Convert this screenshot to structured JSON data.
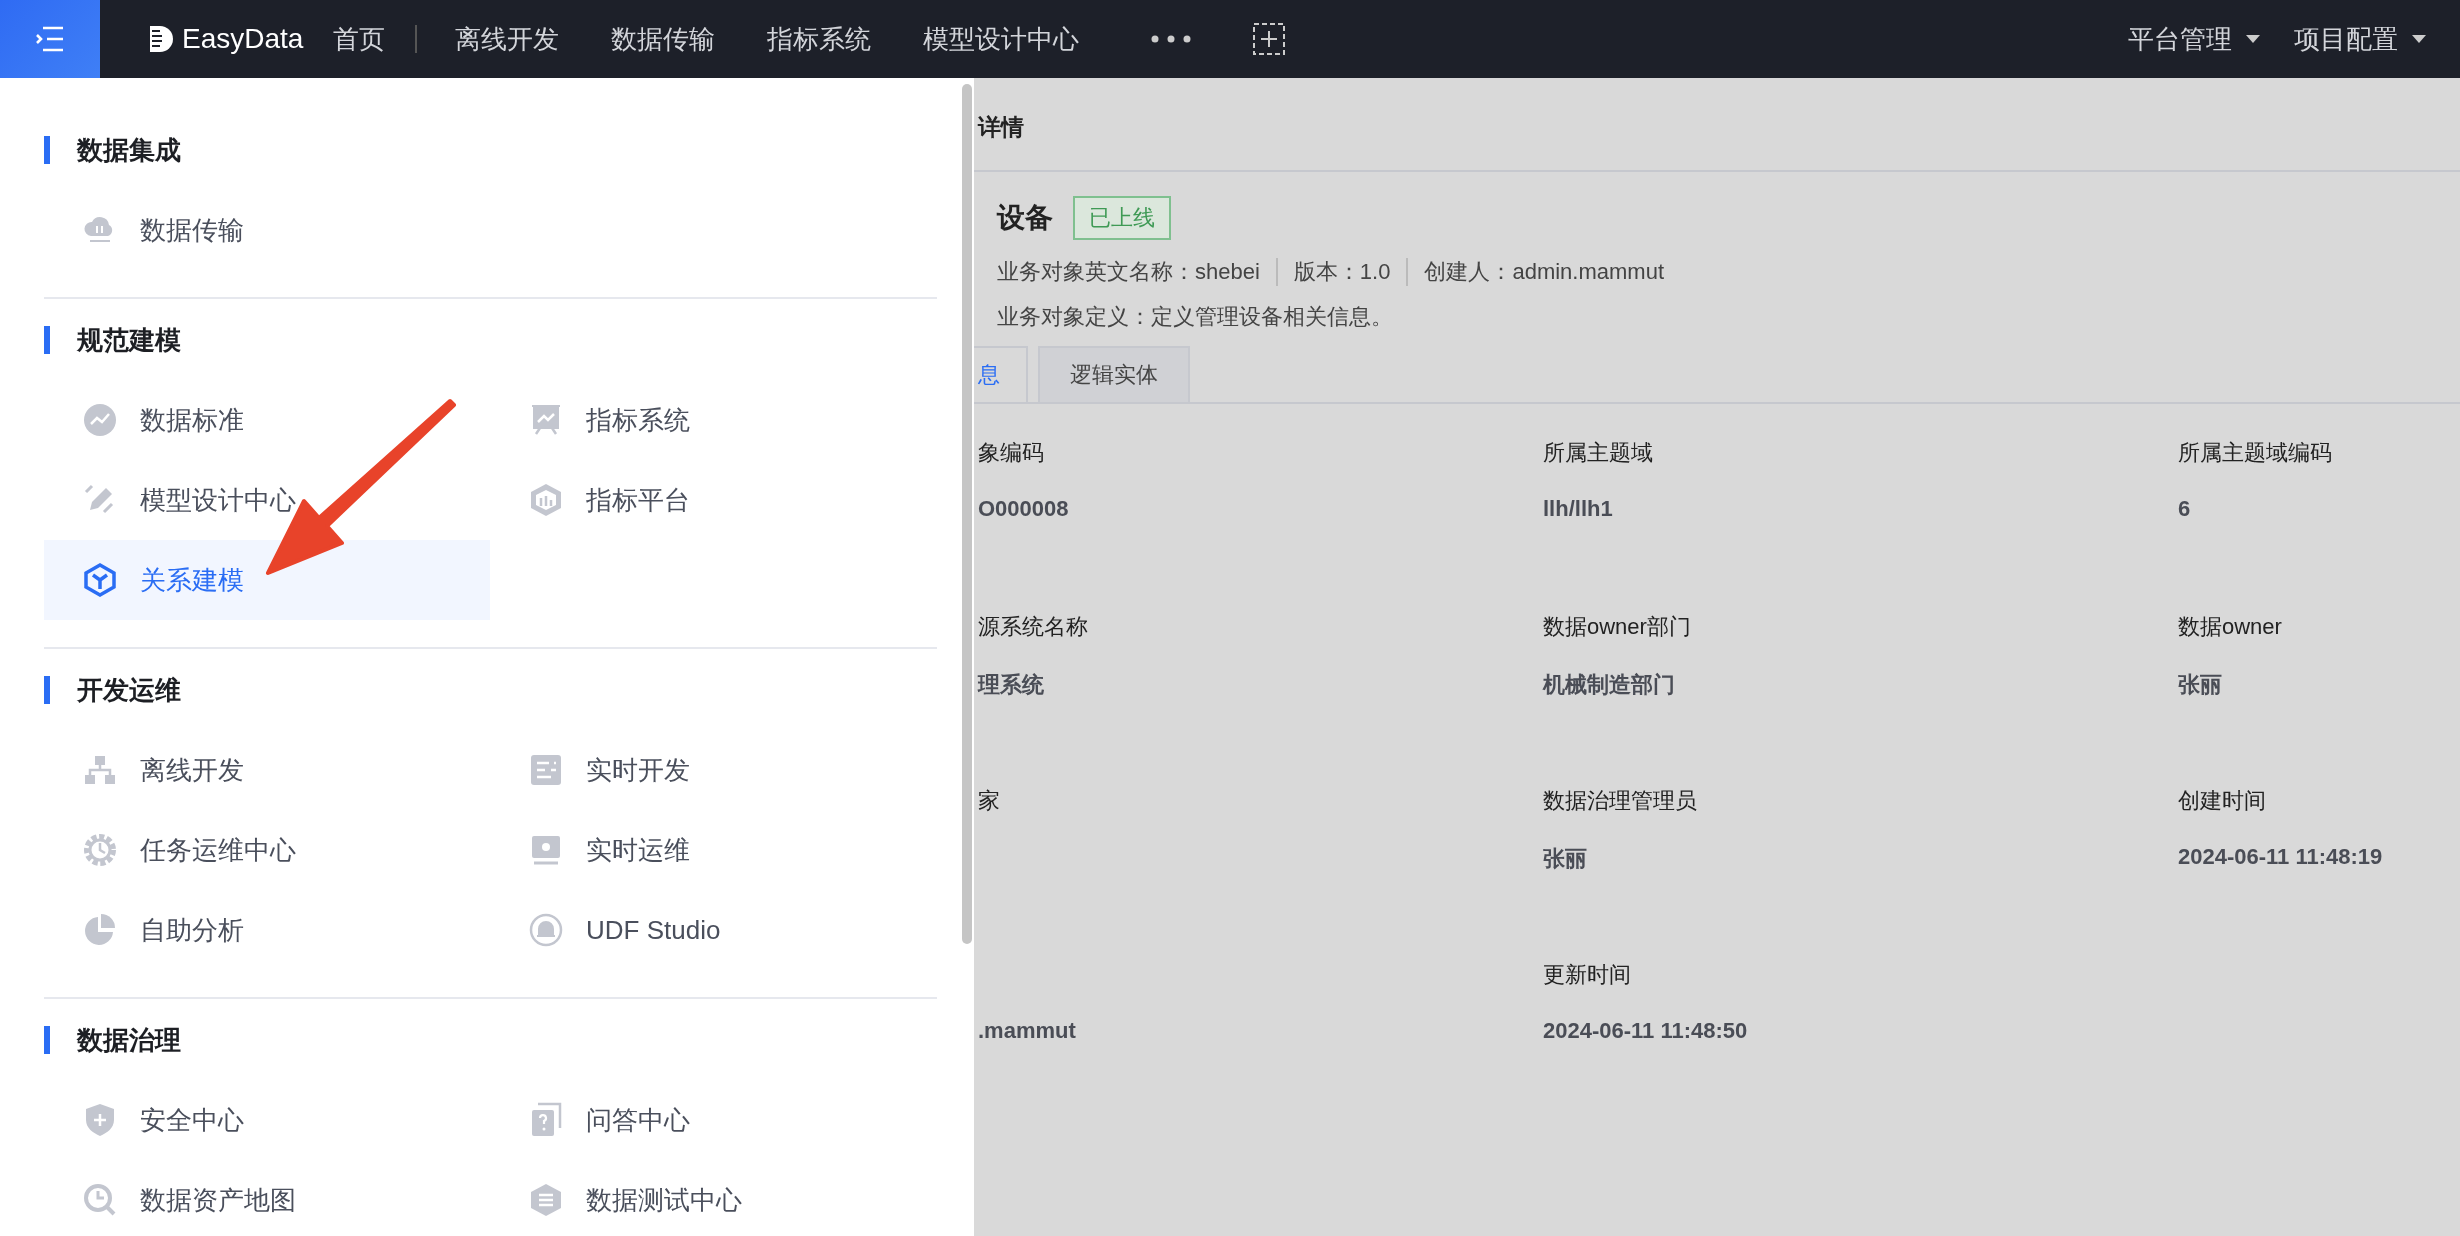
{
  "topbar": {
    "logo": "EasyData",
    "nav": [
      {
        "label": "首页"
      },
      {
        "label": "离线开发"
      },
      {
        "label": "数据传输"
      },
      {
        "label": "指标系统"
      },
      {
        "label": "模型设计中心"
      }
    ],
    "right_menus": [
      {
        "label": "平台管理"
      },
      {
        "label": "项目配置"
      }
    ]
  },
  "menu": {
    "sections": [
      {
        "title": "数据集成",
        "items": [
          {
            "label": "数据传输",
            "kind": "cloud",
            "selected": false
          }
        ]
      },
      {
        "title": "规范建模",
        "items": [
          {
            "label": "数据标准",
            "kind": "trend",
            "selected": false
          },
          {
            "label": "指标系统",
            "kind": "board",
            "selected": false
          },
          {
            "label": "模型设计中心",
            "kind": "pencil",
            "selected": false
          },
          {
            "label": "指标平台",
            "kind": "hexagon",
            "selected": false
          },
          {
            "label": "关系建模",
            "kind": "cube",
            "selected": true
          }
        ]
      },
      {
        "title": "开发运维",
        "items": [
          {
            "label": "离线开发",
            "kind": "hierarchy",
            "selected": false
          },
          {
            "label": "实时开发",
            "kind": "sliders",
            "selected": false
          },
          {
            "label": "任务运维中心",
            "kind": "gear",
            "selected": false
          },
          {
            "label": "实时运维",
            "kind": "monitor",
            "selected": false
          },
          {
            "label": "自助分析",
            "kind": "pie",
            "selected": false
          },
          {
            "label": "UDF Studio",
            "kind": "bell",
            "selected": false
          }
        ]
      },
      {
        "title": "数据治理",
        "items": [
          {
            "label": "安全中心",
            "kind": "shield",
            "selected": false
          },
          {
            "label": "问答中心",
            "kind": "question",
            "selected": false
          },
          {
            "label": "数据资产地图",
            "kind": "magnifier",
            "selected": false
          },
          {
            "label": "数据测试中心",
            "kind": "list",
            "selected": false
          }
        ]
      }
    ]
  },
  "detail": {
    "title": "详情",
    "name": "设备",
    "status": {
      "label": "已上线",
      "kind": "online"
    },
    "meta": [
      "业务对象英文名称：shebei",
      "版本：1.0",
      "创建人：admin.mammut"
    ],
    "definition": "业务对象定义：定义管理设备相关信息。",
    "tabs": [
      {
        "label": "息",
        "selected": true
      },
      {
        "label": "逻辑实体",
        "selected": false
      }
    ],
    "rows": [
      [
        {
          "label": "象编码",
          "value": "O000008"
        },
        {
          "label": "所属主题域",
          "value": "llh/llh1"
        },
        {
          "label": "所属主题域编码",
          "value": "6"
        }
      ],
      [
        {
          "label": "源系统名称",
          "value": "理系统"
        },
        {
          "label": "数据owner部门",
          "value": "机械制造部门"
        },
        {
          "label": "数据owner",
          "value": "张丽"
        }
      ],
      [
        {
          "label": "家"
        },
        {
          "label": "数据治理管理员",
          "value": "张丽"
        },
        {
          "label": "创建时间",
          "value": "2024-06-11 11:48:19"
        }
      ],
      [
        {
          "value": ".mammut"
        },
        {
          "label": "更新时间",
          "value": "2024-06-11 11:48:50"
        }
      ]
    ]
  }
}
